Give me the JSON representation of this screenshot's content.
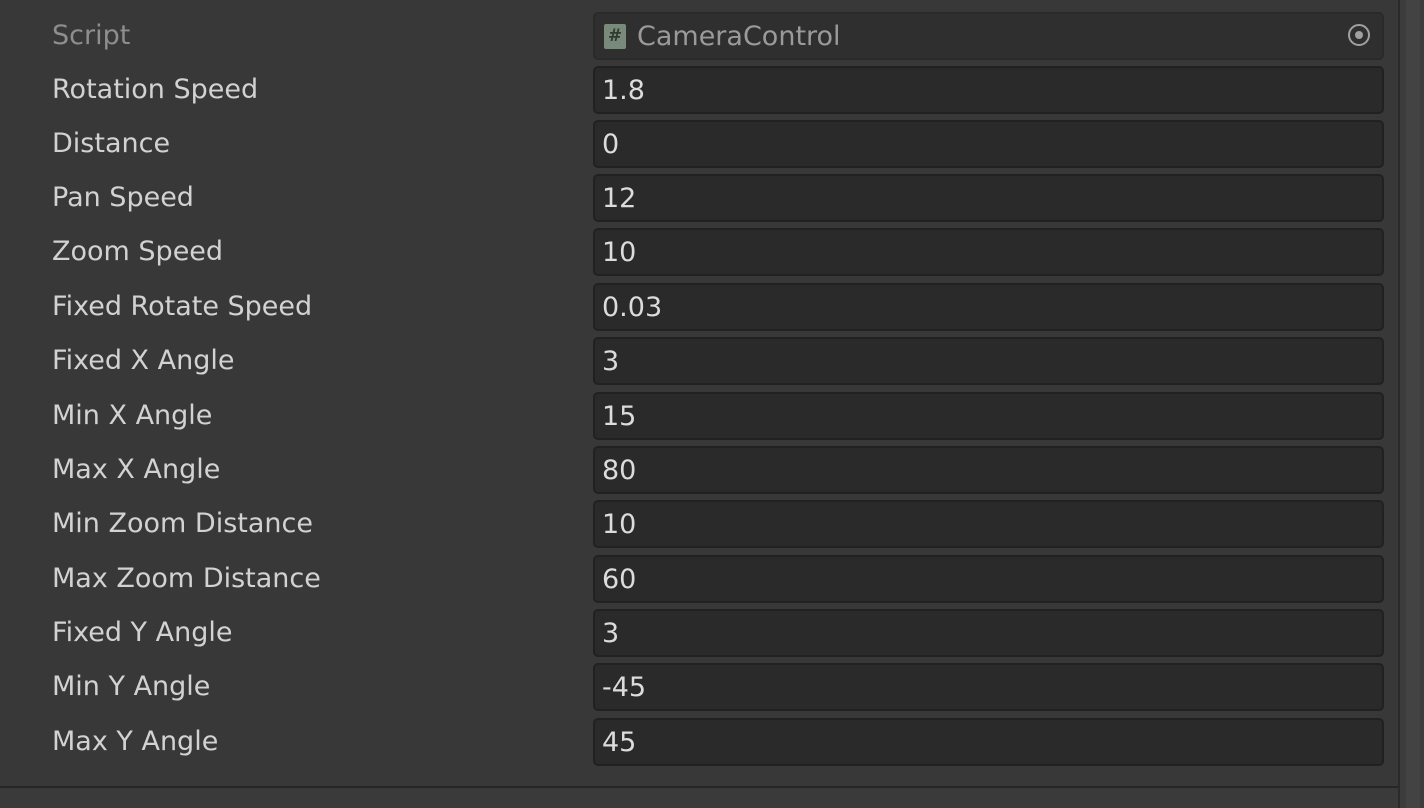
{
  "script": {
    "label": "Script",
    "value": "CameraControl",
    "icon": "csharp-script-icon",
    "picker_icon": "object-picker-icon"
  },
  "fields": [
    {
      "label": "Rotation Speed",
      "value": "1.8"
    },
    {
      "label": "Distance",
      "value": "0"
    },
    {
      "label": "Pan Speed",
      "value": "12"
    },
    {
      "label": "Zoom Speed",
      "value": "10"
    },
    {
      "label": "Fixed Rotate Speed",
      "value": "0.03"
    },
    {
      "label": "Fixed X Angle",
      "value": "3"
    },
    {
      "label": "Min X Angle",
      "value": "15"
    },
    {
      "label": "Max X Angle",
      "value": "80"
    },
    {
      "label": "Min Zoom Distance",
      "value": "10"
    },
    {
      "label": "Max Zoom Distance",
      "value": "60"
    },
    {
      "label": "Fixed Y Angle",
      "value": "3"
    },
    {
      "label": "Min Y Angle",
      "value": "-45"
    },
    {
      "label": "Max Y Angle",
      "value": "45"
    }
  ],
  "colors": {
    "panel_bg": "#383838",
    "field_bg": "#2a2a2a",
    "label_text": "#d2d2d2",
    "value_text": "#dcdcdc",
    "disabled_text": "#8e8e8e"
  }
}
